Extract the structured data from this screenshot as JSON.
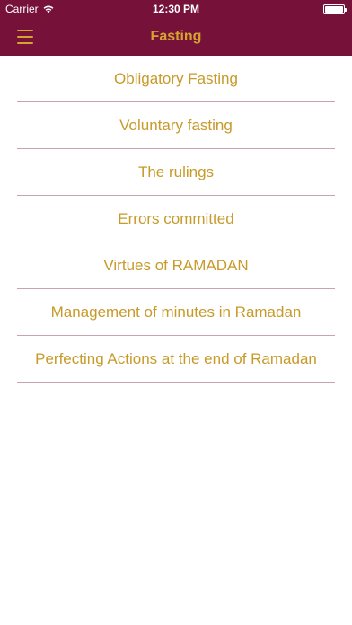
{
  "status_bar": {
    "carrier": "Carrier",
    "time": "12:30 PM",
    "wifi_icon": "wifi-icon",
    "battery_icon": "battery-icon"
  },
  "nav": {
    "title": "Fasting",
    "menu_icon": "hamburger-menu-icon"
  },
  "colors": {
    "header_bg": "#76123a",
    "accent_gold": "#c79a2a",
    "divider": "#c9a3ad"
  },
  "topics": [
    {
      "label": "Obligatory Fasting"
    },
    {
      "label": "Voluntary fasting"
    },
    {
      "label": "The rulings"
    },
    {
      "label": "Errors committed"
    },
    {
      "label": "Virtues of RAMADAN"
    },
    {
      "label": "Management of minutes in Ramadan"
    },
    {
      "label": "Perfecting Actions at the end of Ramadan"
    }
  ]
}
